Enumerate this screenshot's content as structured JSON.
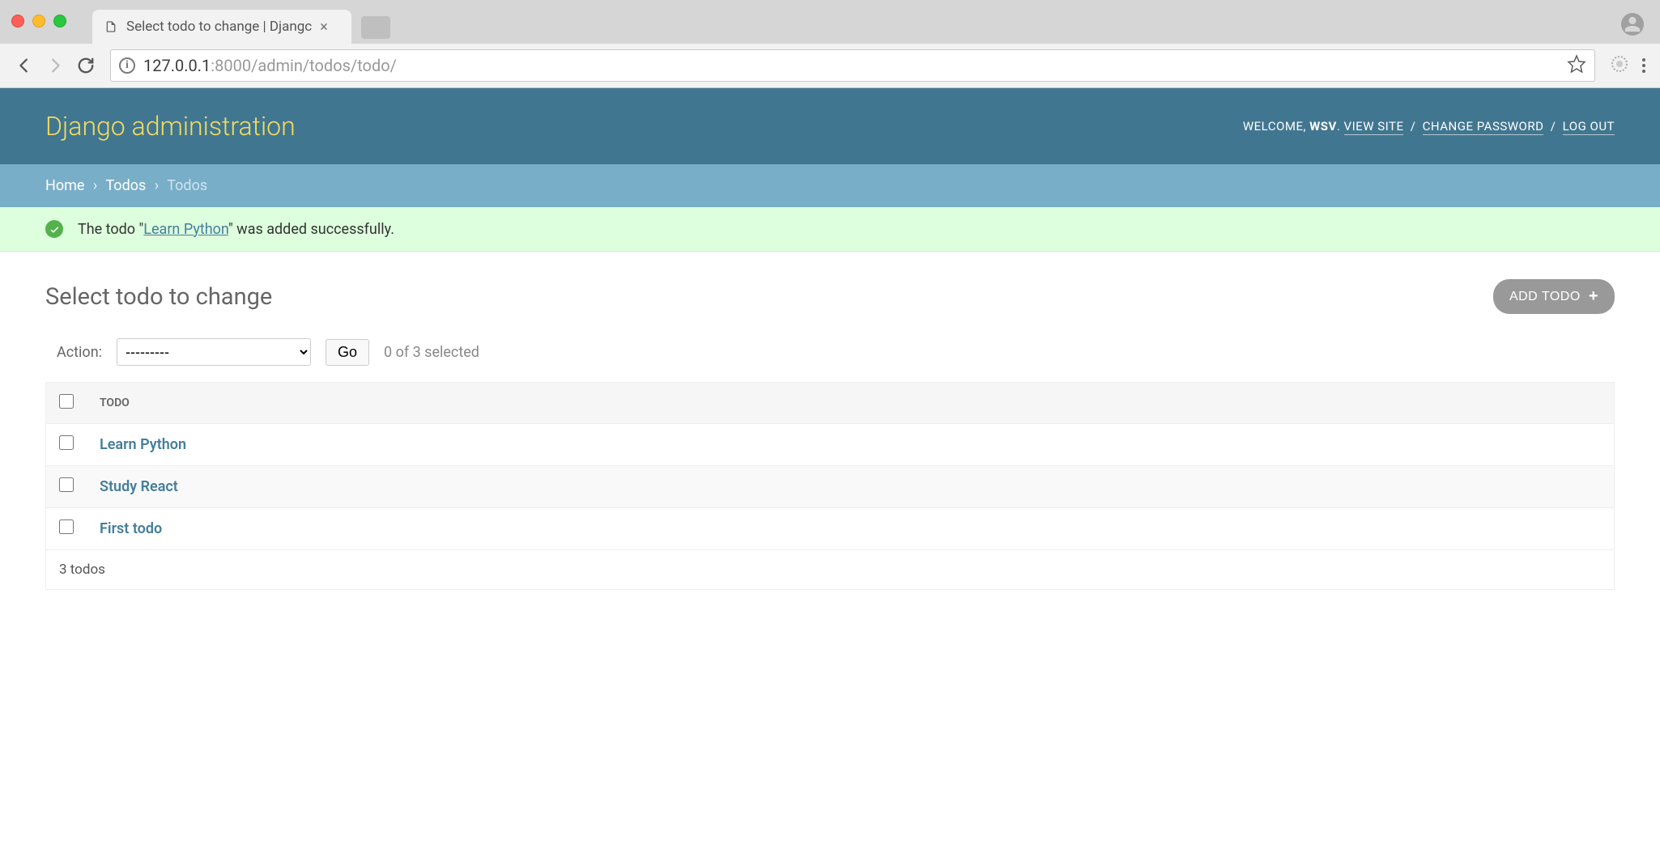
{
  "browser": {
    "tab_title": "Select todo to change | Djangc",
    "url_host": "127.0.0.1",
    "url_port_path": ":8000/admin/todos/todo/"
  },
  "header": {
    "brand": "Django administration",
    "welcome_prefix": "WELCOME,",
    "username": "WSV",
    "view_site": "VIEW SITE",
    "change_password": "CHANGE PASSWORD",
    "logout": "LOG OUT"
  },
  "breadcrumb": {
    "home": "Home",
    "app": "Todos",
    "current": "Todos"
  },
  "message": {
    "prefix": "The todo \"",
    "link": "Learn Python",
    "suffix": "\" was added successfully."
  },
  "content": {
    "title": "Select todo to change",
    "add_button": "ADD TODO",
    "action_label": "Action:",
    "action_placeholder": "---------",
    "go_label": "Go",
    "selection_count": "0 of 3 selected",
    "column_header": "TODO",
    "rows": [
      {
        "title": "Learn Python"
      },
      {
        "title": "Study React"
      },
      {
        "title": "First todo"
      }
    ],
    "paginator": "3 todos"
  }
}
